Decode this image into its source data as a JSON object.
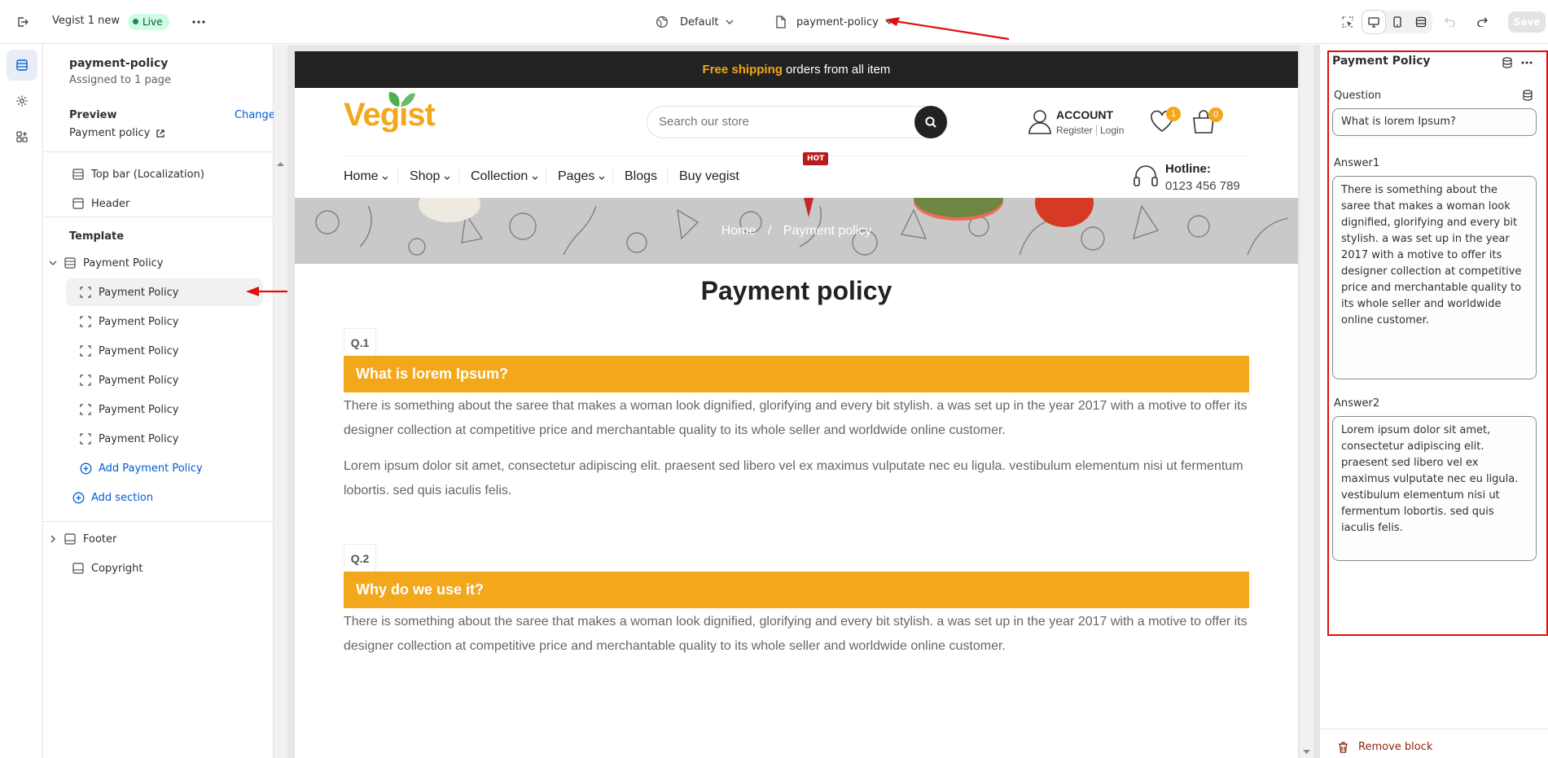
{
  "topbar": {
    "store_name": "Vegist 1 new",
    "status_badge": "Live",
    "theme_selector": "Default",
    "template_selector": "payment-policy",
    "save_label": "Save"
  },
  "left_panel": {
    "template_name": "payment-policy",
    "assigned": "Assigned to 1 page",
    "preview_label": "Preview",
    "change_label": "Change",
    "preview_page": "Payment policy",
    "header_items": [
      "Top bar (Localization)",
      "Header"
    ],
    "template_heading": "Template",
    "section_name": "Payment Policy",
    "blocks": [
      "Payment Policy",
      "Payment Policy",
      "Payment Policy",
      "Payment Policy",
      "Payment Policy",
      "Payment Policy"
    ],
    "add_block": "Add Payment Policy",
    "add_section": "Add section",
    "footer_items": [
      "Footer",
      "Copyright"
    ]
  },
  "preview": {
    "announce_highlight": "Free shipping",
    "announce_rest": " orders from all item",
    "logo": "Vegist",
    "search_placeholder": "Search our store",
    "account_title": "ACCOUNT",
    "register": "Register",
    "login": "Login",
    "wishlist_count": "1",
    "cart_count": "0",
    "nav": [
      "Home",
      "Shop",
      "Collection",
      "Pages",
      "Blogs",
      "Buy vegist"
    ],
    "hot_badge": "HOT",
    "hotline_label": "Hotline:",
    "hotline_number": "0123 456 789",
    "breadcrumb_home": "Home",
    "breadcrumb_sep": "/",
    "breadcrumb_current": "Payment policy",
    "page_title": "Payment policy",
    "faqs": [
      {
        "tag": "Q.1",
        "question": "What is lorem Ipsum?",
        "answer1": "There is something about the saree that makes a woman look dignified, glorifying and every bit stylish. a was set up in the year 2017 with a motive to offer its designer collection at competitive price and merchantable quality to its whole seller and worldwide online customer.",
        "answer2": "Lorem ipsum dolor sit amet, consectetur adipiscing elit. praesent sed libero vel ex maximus vulputate nec eu ligula. vestibulum elementum nisi ut fermentum lobortis. sed quis iaculis felis."
      },
      {
        "tag": "Q.2",
        "question": "Why do we use it?",
        "answer1": "There is something about the saree that makes a woman look dignified, glorifying and every bit stylish. a was set up in the year 2017 with a motive to offer its designer collection at competitive price and merchantable quality to its whole seller and worldwide online customer."
      }
    ]
  },
  "right_panel": {
    "title": "Payment Policy",
    "question_label": "Question",
    "question_value": "What is lorem Ipsum?",
    "answer1_label": "Answer1",
    "answer1_value": "There is something about the saree that makes a woman look dignified, glorifying and every bit stylish. a was set up in the year 2017 with a motive to offer its designer collection at competitive price and merchantable quality to its whole seller and worldwide online customer.",
    "answer2_label": "Answer2",
    "answer2_value": "Lorem ipsum dolor sit amet, consectetur adipiscing elit. praesent sed libero vel ex maximus vulputate nec eu ligula. vestibulum elementum nisi ut fermentum lobortis. sed quis iaculis felis.",
    "remove_label": "Remove block"
  },
  "colors": {
    "accent": "#f3a71b",
    "annotation": "#e01010",
    "link": "#005bd3"
  }
}
